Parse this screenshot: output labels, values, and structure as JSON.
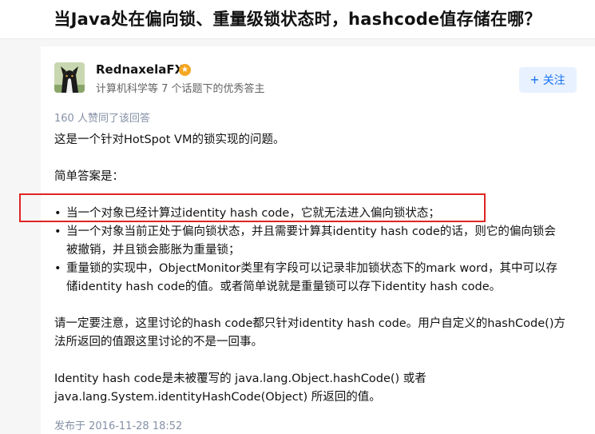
{
  "question": {
    "title": "当Java处在偏向锁、重量级锁状态时，hashcode值存储在哪？"
  },
  "author": {
    "name": "RednaxelaFX",
    "headline": "计算机科学等 7 个话题下的优秀答主",
    "badge_icon": "star-badge-icon",
    "follow_label": "关注",
    "follow_icon": "plus-icon"
  },
  "answer": {
    "votes_text": "160 人赞同了该回答",
    "intro": "这是一个针对HotSpot VM的锁实现的问题。",
    "short_answer_label": "简单答案是：",
    "bullets": [
      {
        "lines": [
          "当一个对象已经计算过identity hash code，它就无法进入偏向锁状态；"
        ]
      },
      {
        "lines": [
          "当一个对象当前正处于偏向锁状态，并且需要计算其identity hash code的话，则它的偏向锁会",
          "被撤销，并且锁会膨胀为重量锁；"
        ]
      },
      {
        "lines": [
          "重量锁的实现中，ObjectMonitor类里有字段可以记录非加锁状态下的mark word，其中可以存",
          "储identity hash code的值。或者简单说就是重量锁可以存下identity hash code。"
        ]
      }
    ],
    "note_lines": [
      "请一定要注意，这里讨论的hash code都只针对identity hash code。用户自定义的hashCode()方",
      "法所返回的值跟这里讨论的不是一回事。"
    ],
    "final_lines": [
      "Identity hash code是未被覆写的 java.lang.Object.hashCode() 或者",
      "java.lang.System.identityHashCode(Object) 所返回的值。"
    ],
    "published": "发布于 2016-11-28 18:52"
  },
  "colors": {
    "accent": "#1772f6",
    "highlight_border": "#e02424",
    "meta_text": "#8590a6",
    "badge": "#f5a623"
  }
}
